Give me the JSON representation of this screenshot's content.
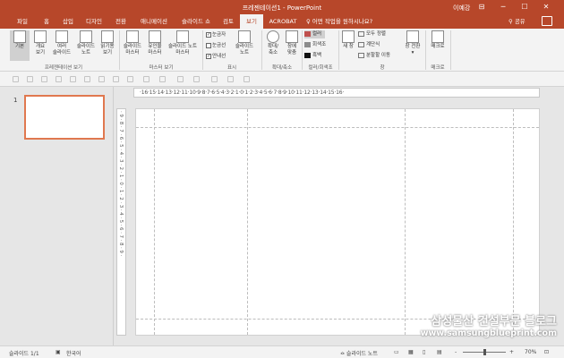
{
  "window": {
    "title": "프레젠테이션1 - PowerPoint",
    "user": "이예강",
    "ribbon_display_icon": "ribbon-display-icon",
    "minimize": "─",
    "maximize": "☐",
    "close": "✕"
  },
  "tabs": [
    {
      "label": "파일"
    },
    {
      "label": "홈"
    },
    {
      "label": "삽입"
    },
    {
      "label": "디자인"
    },
    {
      "label": "전환"
    },
    {
      "label": "애니메이션"
    },
    {
      "label": "슬라이드 쇼"
    },
    {
      "label": "검토"
    },
    {
      "label": "보기",
      "active": true
    },
    {
      "label": "ACROBAT"
    }
  ],
  "tell_me": "♀ 어떤 작업을 원하시나요?",
  "share": "⚲ 공유",
  "ribbon": {
    "presentation_views": {
      "group_label": "프레젠테이션 보기",
      "normal": "기본",
      "outline": "개요\n보기",
      "sorter": "여러\n슬라이드",
      "notes_page": "슬라이드\n노트",
      "reading": "읽기용\n보기"
    },
    "master_views": {
      "group_label": "마스터 보기",
      "slide_master": "슬라이드\n마스터",
      "handout_master": "유인물\n마스터",
      "notes_master": "슬라이드 노트\n마스터"
    },
    "show": {
      "group_label": "표시",
      "ruler": "눈금자",
      "gridlines": "눈금선",
      "guides": "안내선",
      "notes": "슬라이드\n노트"
    },
    "zoom": {
      "group_label": "확대/축소",
      "zoom": "확대/\n축소",
      "fit": "창에\n맞춤"
    },
    "color": {
      "group_label": "컬러/회색조",
      "color": "컬러",
      "grayscale": "회색조",
      "bw": "흑백"
    },
    "window": {
      "group_label": "창",
      "new_window": "새 창",
      "arrange_all": "모두 정렬",
      "cascade": "계단식",
      "move_split": "분할할 이동",
      "switch": "창 전환"
    },
    "macros": {
      "group_label": "매크로",
      "macros": "매크로"
    }
  },
  "thumbnails": [
    {
      "number": "1"
    }
  ],
  "rulers": {
    "horizontal": "·16·15·14·13·12·11·10·9·8·7·6·5·4·3·2·1·0·1·2·3·4·5·6·7·8·9·10·11·12·13·14·15·16·",
    "vertical": "·9·8·7·6·5·4·3·2·1·0·1·2·3·4·5·6·7·8·9·"
  },
  "status": {
    "slide_counter": "슬라이드 1/1",
    "language": "한국어",
    "notes": "≏ 슬라이드 노트",
    "zoom_minus": "-",
    "zoom_plus": "+",
    "zoom_level": "70%",
    "fit_icon": "⊡"
  },
  "watermark": {
    "line1": "삼성물산 건설부문 블로그",
    "line2": "www.samsungblueprint.com"
  },
  "colors": {
    "accent": "#b7472a",
    "selection_border": "#e0784f"
  }
}
